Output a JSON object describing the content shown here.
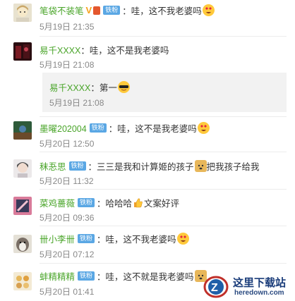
{
  "comments": [
    {
      "user": "笔袋不装笔",
      "badge": "铁粉",
      "text": "：哇，这不我老婆吗",
      "time": "5月19日 21:35"
    },
    {
      "user": "易千XXXX",
      "text": "：哇，这不是我老婆吗",
      "time": "5月19日 21:08",
      "reply": {
        "user": "易千XXXX",
        "text": "：第一",
        "time": "5月19日 21:08"
      }
    },
    {
      "user": "墨曜202004",
      "badge": "铁粉",
      "text": "：哇，这不是我老婆吗",
      "time": "5月20日 12:50"
    },
    {
      "user": "秣忢思",
      "badge": "铁粉",
      "text": "：三三是我和计算姬的孩子",
      "text2": "把我孩子给我",
      "time": "5月20日 11:32"
    },
    {
      "user": "菜鸡薔薇",
      "badge": "铁粉",
      "text": "：哈哈哈",
      "text2": "文案好评",
      "time": "5月20日 09:36"
    },
    {
      "user": "卌小李卌",
      "badge": "铁粉",
      "text": "：哇，这不我老婆吗",
      "time": "5月20日 07:12"
    },
    {
      "user": "蚌精精精",
      "badge": "铁粉",
      "text": "：哇，这不就是我老婆吗",
      "time": "5月20日 01:41"
    }
  ],
  "watermark": {
    "title": "这里下载站",
    "url": "heredown.com"
  }
}
